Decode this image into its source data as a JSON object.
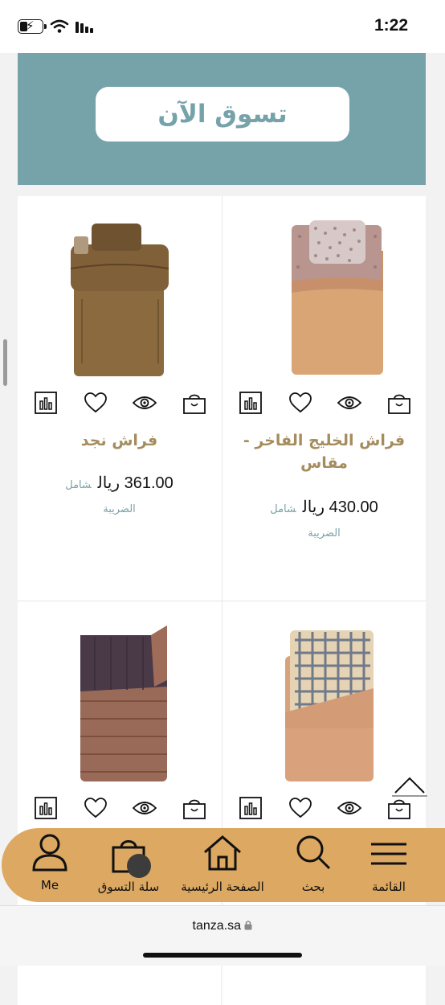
{
  "status_bar": {
    "time": "1:22",
    "battery_icon": "battery-charging-icon",
    "wifi_icon": "wifi-icon",
    "signal_icon": "cellular-signal-icon"
  },
  "hero": {
    "button_label": "تسوق الآن",
    "background_color": "#76a2a9"
  },
  "products": [
    {
      "name": "فراش الخليج الفاخر - مقاس",
      "price": "430.00 ريال",
      "incl": "شامل",
      "tax": "الضريبة",
      "image": "sleeping-bag-brown-checkered-pillow"
    },
    {
      "name": "فراش نجد",
      "price": "361.00 ريال",
      "incl": "شامل",
      "tax": "الضريبة",
      "image": "sleeping-bag-dark-brown"
    },
    {
      "image": "sleeping-bag-checkered-flannel"
    },
    {
      "image": "sleeping-bag-quilted-purple"
    }
  ],
  "card_actions": [
    "compare-icon",
    "heart-icon",
    "eye-icon",
    "shopping-bag-icon"
  ],
  "nav": {
    "menu": "القائمة",
    "search": "بحث",
    "home": "الصفحة الرئيسية",
    "cart": "سلة التسوق",
    "me": "Me",
    "color": "#dca862"
  },
  "browser": {
    "url": "tanza.sa"
  }
}
